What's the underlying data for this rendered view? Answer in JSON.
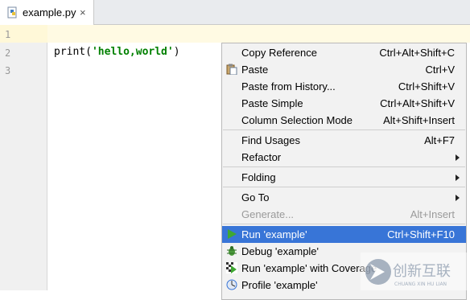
{
  "tab": {
    "filename": "example.py",
    "close": "×"
  },
  "editor": {
    "line_numbers": [
      "1",
      "2",
      "3"
    ],
    "code_fn": "print(",
    "code_str": "'hello,world'",
    "code_end": ")"
  },
  "menu": {
    "copy_reference": {
      "label": "Copy Reference",
      "shortcut": "Ctrl+Alt+Shift+C"
    },
    "paste": {
      "label": "Paste",
      "shortcut": "Ctrl+V"
    },
    "paste_history": {
      "label": "Paste from History...",
      "shortcut": "Ctrl+Shift+V"
    },
    "paste_simple": {
      "label": "Paste Simple",
      "shortcut": "Ctrl+Alt+Shift+V"
    },
    "column_selection": {
      "label": "Column Selection Mode",
      "shortcut": "Alt+Shift+Insert"
    },
    "find_usages": {
      "label": "Find Usages",
      "shortcut": "Alt+F7"
    },
    "refactor": {
      "label": "Refactor"
    },
    "folding": {
      "label": "Folding"
    },
    "goto": {
      "label": "Go To"
    },
    "generate": {
      "label": "Generate...",
      "shortcut": "Alt+Insert"
    },
    "run": {
      "label": "Run 'example'",
      "shortcut": "Ctrl+Shift+F10"
    },
    "debug": {
      "label": "Debug 'example'"
    },
    "run_coverage": {
      "label": "Run 'example' with Coverage"
    },
    "profile": {
      "label": "Profile 'example'"
    }
  },
  "watermark": {
    "text": "创新互联",
    "subtext": "CHUANG XIN HU LIAN"
  },
  "colors": {
    "selection": "#3875d7",
    "current_line": "#fffae3",
    "string": "#008000"
  }
}
